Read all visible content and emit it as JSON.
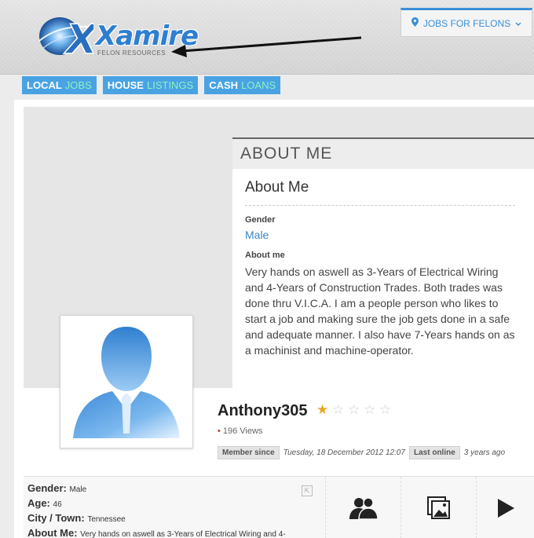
{
  "header": {
    "logo_text": "Xamire",
    "logo_tagline": "FELON RESOURCES",
    "jobs_button": "JOBS FOR FELONS"
  },
  "nav": [
    {
      "main": "LOCAL",
      "highlight": "JOBS"
    },
    {
      "main": "HOUSE",
      "highlight": "LISTINGS"
    },
    {
      "main": "CASH",
      "highlight": "LOANS"
    }
  ],
  "about": {
    "header": "ABOUT ME",
    "title": "About Me",
    "gender_label": "Gender",
    "gender_value": "Male",
    "about_label": "About me",
    "about_text": "Very hands on aswell as 3-Years of Electrical Wiring and 4-Years of Construction Trades. Both trades was done thru V.I.C.A. I am a people person who likes to start a job and making sure the job gets done in a safe and adequate manner. I also have 7-Years hands on as a machinist and machine-operator."
  },
  "profile": {
    "username": "Anthony305",
    "rating": 1.5,
    "rating_max": 5,
    "views": "196 Views",
    "member_since_label": "Member since",
    "member_since": "Tuesday, 18 December 2012 12:07",
    "last_online_label": "Last online",
    "last_online": "3 years ago"
  },
  "info": {
    "gender_label": "Gender:",
    "gender": "Male",
    "age_label": "Age:",
    "age": "46",
    "city_label": "City / Town:",
    "city": "Tennessee",
    "about_label": "About Me:",
    "about": "Very hands on aswell as 3-Years of Electrical Wiring and 4-"
  },
  "colors": {
    "accent": "#49a3e3",
    "nav_highlight": "#8ff0c2",
    "link": "#3a86c8"
  },
  "icons": {
    "friends": "friends-icon",
    "photos": "photos-icon",
    "videos": "play-icon"
  }
}
